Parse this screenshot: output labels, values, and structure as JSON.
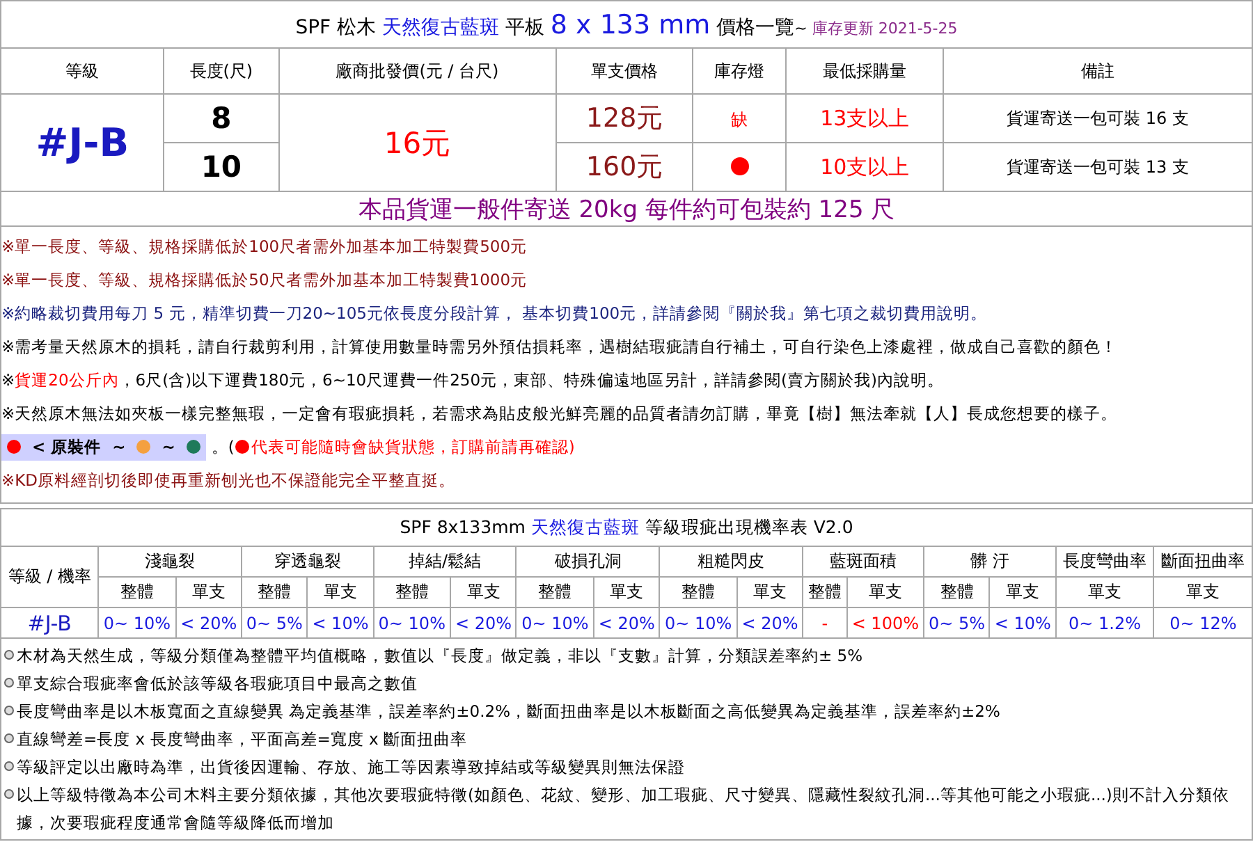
{
  "price_table": {
    "title": [
      {
        "kind": "plain",
        "text": "SPF  松木 "
      },
      {
        "kind": "accent",
        "text": "天然復古藍斑"
      },
      {
        "kind": "plain",
        "text": " 平板 "
      },
      {
        "kind": "size",
        "text": "8 x 133 mm"
      },
      {
        "kind": "plain",
        "text": " 價格一覽"
      },
      {
        "kind": "small",
        "text": "~ "
      },
      {
        "kind": "note",
        "text": "庫存更新 2021-5-25"
      }
    ],
    "columns": [
      "等級",
      "長度(尺)",
      "廠商批發價(元 / 台尺)",
      "單支價格",
      "庫存燈",
      "最低採購量",
      "備註"
    ],
    "grade": "#J-B",
    "wholesale_price": "16元",
    "rows": [
      {
        "length": "8",
        "unit_price": "128元",
        "stock": {
          "kind": "text",
          "text": "缺"
        },
        "min_order": "13支以上",
        "remark": "貨運寄送一包可裝 16  支"
      },
      {
        "length": "10",
        "unit_price": "160元",
        "stock": {
          "kind": "dot",
          "color": "#ff0000"
        },
        "min_order": "10支以上",
        "remark": "貨運寄送一包可裝 13  支"
      }
    ],
    "shipping_banner": "本品貨運一般件寄送 20kg 每件約可包裝約 125 尺"
  },
  "notes": [
    {
      "kind": "text",
      "segments": [
        {
          "color": "#8b1010",
          "text": "※單一長度、等級、規格採購低於100尺者需外加基本加工特製費500元"
        }
      ]
    },
    {
      "kind": "text",
      "segments": [
        {
          "color": "#8b1010",
          "text": "※單一長度、等級、規格採購低於50尺者需外加基本加工特製費1000元"
        }
      ]
    },
    {
      "kind": "text",
      "segments": [
        {
          "color": "#1a237e",
          "text": "※約略裁切費用每刀 5 元，精準切費一刀20~105元依長度分段計算， 基本切費100元，詳請參閱『關於我』第七項之裁切費用說明。"
        }
      ]
    },
    {
      "kind": "text",
      "segments": [
        {
          "color": "#000000",
          "text": "※需考量天然原木的損耗，請自行裁剪利用，計算使用數量時需另外預估損耗率，遇樹結瑕疵請自行補土，可自行染色上漆處裡，做成自己喜歡的顏色！"
        }
      ]
    },
    {
      "kind": "text",
      "segments": [
        {
          "color": "#000000",
          "text": "※"
        },
        {
          "color": "#ff0000",
          "text": "貨運20公斤內"
        },
        {
          "color": "#000000",
          "text": "，6尺(含)以下運費180元，6~10尺運費一件250元，東部、特殊偏遠地區另計，詳請參閱(賣方關於我)內說明。"
        }
      ]
    },
    {
      "kind": "text",
      "segments": [
        {
          "color": "#000000",
          "text": "※天然原木無法如夾板一樣完整無瑕，一定會有瑕疵損耗，若需求為貼皮般光鮮亮麗的品質者請勿訂購，畢竟【樹】無法牽就【人】長成您想要的樣子。"
        }
      ]
    },
    {
      "kind": "legend",
      "items": [
        {
          "kind": "dot",
          "color": "#ff0000"
        },
        {
          "kind": "text",
          "text": "< 原裝件"
        },
        {
          "kind": "text",
          "text": "~"
        },
        {
          "kind": "dot",
          "color": "#f4a040"
        },
        {
          "kind": "text",
          "text": "~"
        },
        {
          "kind": "dot",
          "color": "#1e7a5a"
        }
      ],
      "after": [
        {
          "kind": "text",
          "color": "#000000",
          "text": "。("
        },
        {
          "kind": "dot",
          "color": "#ff0000"
        },
        {
          "kind": "text",
          "color": "#ff0000",
          "text": "代表可能隨時會缺貨狀態，訂購前請再確認)"
        }
      ]
    },
    {
      "kind": "text",
      "segments": [
        {
          "color": "#8b1010",
          "text": "※KD原料經剖切後即使再重新刨光也不保證能完全平整直挺。"
        }
      ]
    }
  ],
  "defect_table": {
    "title": [
      {
        "kind": "plain",
        "text": "SPF 8x133mm "
      },
      {
        "kind": "accent",
        "text": "天然復古藍斑"
      },
      {
        "kind": "plain",
        "text": " 等級瑕疵出現機率表 V2.0"
      }
    ],
    "corner": "等級 / 機率",
    "categories": [
      {
        "name": "淺龜裂",
        "sub": [
          "整體",
          "單支"
        ]
      },
      {
        "name": "穿透龜裂",
        "sub": [
          "整體",
          "單支"
        ]
      },
      {
        "name": "掉結/鬆結",
        "sub": [
          "整體",
          "單支"
        ]
      },
      {
        "name": "破損孔洞",
        "sub": [
          "整體",
          "單支"
        ]
      },
      {
        "name": "粗糙閃皮",
        "sub": [
          "整體",
          "單支"
        ]
      },
      {
        "name": "藍斑面積",
        "sub": [
          "整體",
          "單支"
        ]
      },
      {
        "name": "髒 汙",
        "sub": [
          "整體",
          "單支"
        ]
      },
      {
        "name": "長度彎曲率",
        "sub": [
          "單支"
        ]
      },
      {
        "name": "斷面扭曲率",
        "sub": [
          "單支"
        ]
      }
    ],
    "rows": [
      {
        "grade": "#J-B",
        "values": [
          {
            "color": "#1a1ae0",
            "text": "0~ 10%"
          },
          {
            "color": "#1a1ae0",
            "text": "< 20%"
          },
          {
            "color": "#1a1ae0",
            "text": "0~ 5%"
          },
          {
            "color": "#1a1ae0",
            "text": "< 10%"
          },
          {
            "color": "#1a1ae0",
            "text": "0~ 10%"
          },
          {
            "color": "#1a1ae0",
            "text": "< 20%"
          },
          {
            "color": "#1a1ae0",
            "text": "0~ 10%"
          },
          {
            "color": "#1a1ae0",
            "text": "< 20%"
          },
          {
            "color": "#1a1ae0",
            "text": "0~ 10%"
          },
          {
            "color": "#1a1ae0",
            "text": "< 20%"
          },
          {
            "color": "#ff0000",
            "text": "-"
          },
          {
            "color": "#ff0000",
            "text": "< 100%"
          },
          {
            "color": "#1a1ae0",
            "text": "0~ 5%"
          },
          {
            "color": "#1a1ae0",
            "text": "< 10%"
          },
          {
            "color": "#1a1ae0",
            "text": "0~ 1.2%"
          },
          {
            "color": "#1a1ae0",
            "text": "0~ 12%"
          }
        ]
      }
    ]
  },
  "footnotes": [
    "木材為天然生成，等級分類僅為整體平均值概略，數值以『長度』做定義，非以『支數』計算，分類誤差率約± 5%",
    "單支綜合瑕疵率會低於該等級各瑕疵項目中最高之數值",
    "長度彎曲率是以木板寬面之直線變異 為定義基準，誤差率約±0.2%，斷面扭曲率是以木板斷面之高低變異為定義基準，誤差率約±2%",
    "直線彎差=長度 x 長度彎曲率，平面高差=寬度 x 斷面扭曲率",
    "等級評定以出廠時為準，出貨後因運輸、存放、施工等因素導致掉結或等級變異則無法保證",
    "以上等級特徵為本公司木料主要分類依據，其他次要瑕疵特徵(如顏色、花紋、變形、加工瑕疵、尺寸變異、隱藏性裂紋孔洞...等其他可能之小瑕疵...)則不計入分類依據，次要瑕疵程度通常會隨等級降低而增加"
  ]
}
